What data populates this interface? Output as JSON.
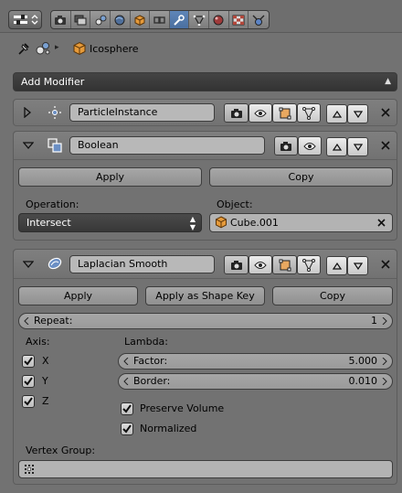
{
  "header": {
    "editor_icon": "properties-editor-icon",
    "contexts": [
      {
        "name": "render-icon"
      },
      {
        "name": "render-layers-icon"
      },
      {
        "name": "scene-icon"
      },
      {
        "name": "world-icon"
      },
      {
        "name": "object-icon"
      },
      {
        "name": "constraints-icon"
      },
      {
        "name": "modifiers-icon",
        "active": true
      },
      {
        "name": "data-icon"
      },
      {
        "name": "material-icon"
      },
      {
        "name": "texture-icon"
      },
      {
        "name": "particles-icon"
      }
    ]
  },
  "breadcrumb": {
    "object_name": "Icosphere"
  },
  "add_modifier_label": "Add Modifier",
  "modifiers": {
    "particle_instance": {
      "name": "ParticleInstance"
    },
    "boolean": {
      "name": "Boolean",
      "apply_label": "Apply",
      "copy_label": "Copy",
      "operation_label": "Operation:",
      "operation_value": "Intersect",
      "object_label": "Object:",
      "object_value": "Cube.001"
    },
    "laplacian": {
      "name": "Laplacian Smooth",
      "apply_label": "Apply",
      "apply_shape_label": "Apply as Shape Key",
      "copy_label": "Copy",
      "repeat_label": "Repeat:",
      "repeat_value": "1",
      "axis_label": "Axis:",
      "axes": [
        {
          "label": "X",
          "checked": true
        },
        {
          "label": "Y",
          "checked": true
        },
        {
          "label": "Z",
          "checked": true
        }
      ],
      "lambda_label": "Lambda:",
      "factor_label": "Factor:",
      "factor_value": "5.000",
      "border_label": "Border:",
      "border_value": "0.010",
      "preserve_volume_label": "Preserve Volume",
      "preserve_volume": true,
      "normalized_label": "Normalized",
      "normalized": true,
      "vertex_group_label": "Vertex Group:",
      "vertex_group_value": ""
    }
  }
}
